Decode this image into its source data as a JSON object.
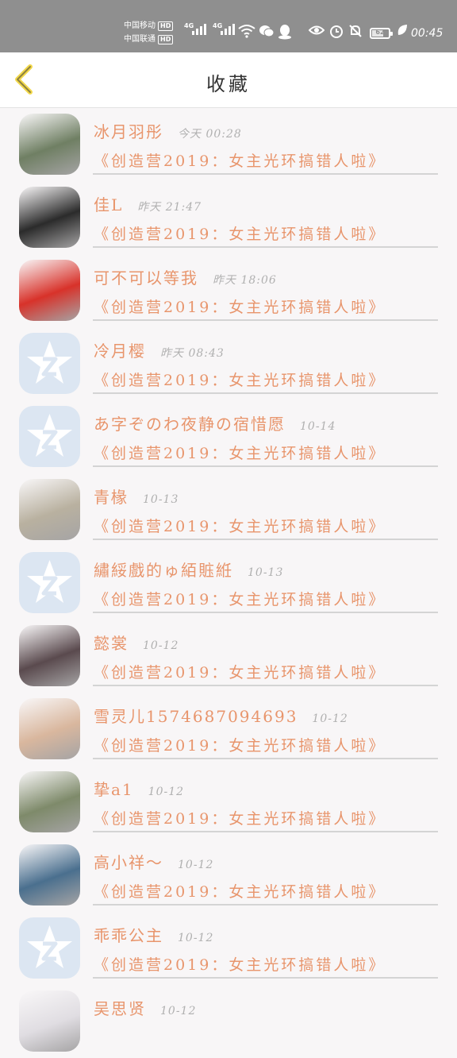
{
  "status_bar": {
    "carrier_1": "中国移动",
    "carrier_2": "中国联通",
    "hd_badge": "HD",
    "net_1": "4G",
    "net_2": "4G",
    "battery_level": "62",
    "battery_fraction": 0.62,
    "time": "00:45",
    "icons": [
      "wifi-icon",
      "wechat-icon",
      "qq-icon",
      "eye-icon",
      "alarm-icon",
      "mute-bell-icon",
      "leaf-icon"
    ]
  },
  "header": {
    "title": "收藏",
    "back_icon": "chevron-left-icon",
    "accent_color": "#f2d84a"
  },
  "list": {
    "items": [
      {
        "name": "冰月羽彤",
        "time": "今天 00:28",
        "title": "《创造营2019：女主光环搞错人啦》",
        "avatar": "photo",
        "avatar_color": "#6f7f63"
      },
      {
        "name": "佳L",
        "time": "昨天 21:47",
        "title": "《创造营2019：女主光环搞错人啦》",
        "avatar": "photo",
        "avatar_color": "#2b2b2b"
      },
      {
        "name": "可不可以等我",
        "time": "昨天 18:06",
        "title": "《创造营2019：女主光环搞错人啦》",
        "avatar": "photo",
        "avatar_color": "#d8322a"
      },
      {
        "name": "冷月樱",
        "time": "昨天 08:43",
        "title": "《创造营2019：女主光环搞错人啦》",
        "avatar": "default"
      },
      {
        "name": "あ字ぞのわ夜静の宿惜愿",
        "time": "10-14",
        "title": "《创造营2019：女主光环搞错人啦》",
        "avatar": "default"
      },
      {
        "name": "青椽",
        "time": "10-13",
        "title": "《创造营2019：女主光环搞错人啦》",
        "avatar": "photo",
        "avatar_color": "#b9b1a0"
      },
      {
        "name": "繡綏戲的ゅ絔賘絍",
        "time": "10-13",
        "title": "《创造营2019：女主光环搞错人啦》",
        "avatar": "default"
      },
      {
        "name": "懿裳",
        "time": "10-12",
        "title": "《创造营2019：女主光环搞错人啦》",
        "avatar": "photo",
        "avatar_color": "#5a4a4e"
      },
      {
        "name": "雪灵儿1574687094693",
        "time": "10-12",
        "title": "《创造营2019：女主光环搞错人啦》",
        "avatar": "photo",
        "avatar_color": "#d9b79e"
      },
      {
        "name": "挚a1",
        "time": "10-12",
        "title": "《创造营2019：女主光环搞错人啦》",
        "avatar": "photo",
        "avatar_color": "#7e8a6a"
      },
      {
        "name": "高小祥～",
        "time": "10-12",
        "title": "《创造营2019：女主光环搞错人啦》",
        "avatar": "photo",
        "avatar_color": "#4a6f8e"
      },
      {
        "name": "乖乖公主",
        "time": "10-12",
        "title": "《创造营2019：女主光环搞错人啦》",
        "avatar": "default"
      },
      {
        "name": "吴思贤",
        "time": "10-12",
        "title": "",
        "avatar": "photo",
        "avatar_color": "#e0dde2"
      }
    ]
  }
}
